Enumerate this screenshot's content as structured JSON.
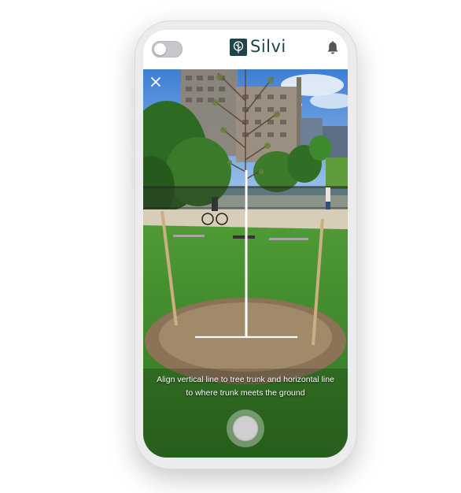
{
  "app": {
    "brand_name": "Silvi",
    "brand_color": "#1f4548",
    "logo_icon": "tree-leaf-icon",
    "notifications_icon": "bell-icon",
    "toggle_state": "off"
  },
  "camera": {
    "close_icon": "close-icon",
    "instruction_line_1": "Align vertical line to tree trunk and horizontal line",
    "instruction_line_2": "to where trunk meets the ground",
    "guide_line_color": "#ffffff",
    "shutter_button": "shutter-button"
  }
}
